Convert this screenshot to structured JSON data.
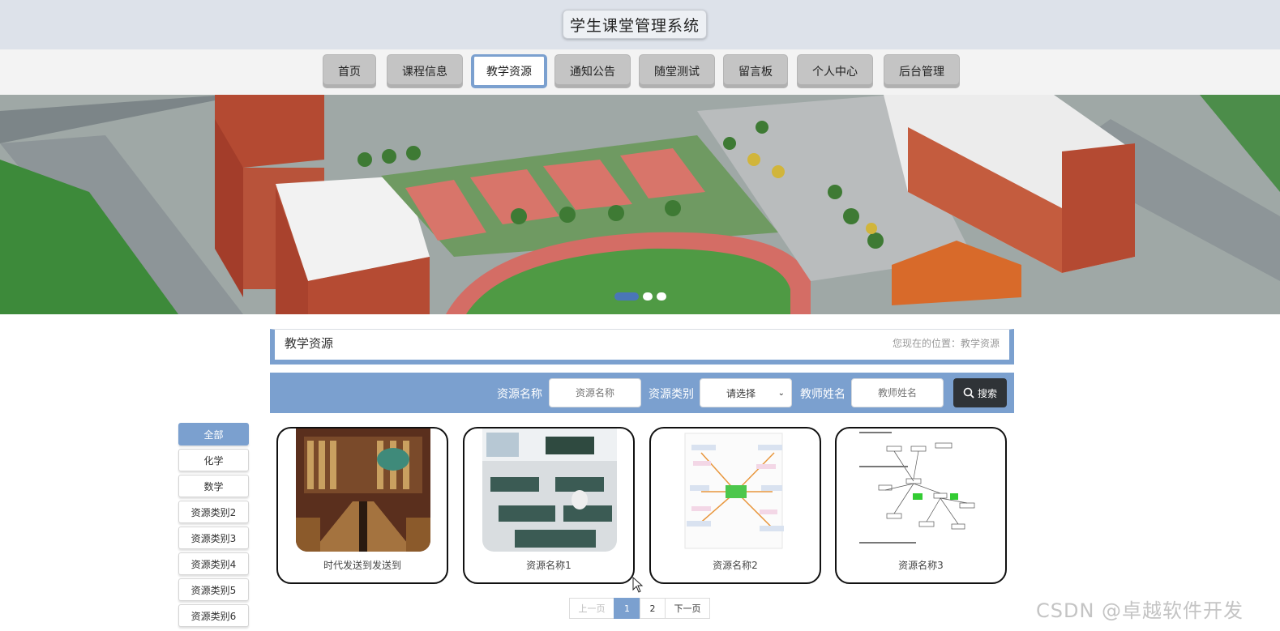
{
  "site": {
    "title": "学生课堂管理系统"
  },
  "nav": {
    "items": [
      {
        "label": "首页"
      },
      {
        "label": "课程信息"
      },
      {
        "label": "教学资源"
      },
      {
        "label": "通知公告"
      },
      {
        "label": "随堂测试"
      },
      {
        "label": "留言板"
      },
      {
        "label": "个人中心"
      },
      {
        "label": "后台管理"
      }
    ],
    "active_index": 2
  },
  "banner": {
    "slide_count": 3,
    "active_slide": 1
  },
  "breadcrumb": {
    "title": "教学资源",
    "path": "您现在的位置：教学资源"
  },
  "search": {
    "name_label": "资源名称",
    "name_placeholder": "资源名称",
    "category_label": "资源类别",
    "category_value": "请选择",
    "teacher_label": "教师姓名",
    "teacher_placeholder": "教师姓名",
    "button_label": "搜索"
  },
  "categories": {
    "items": [
      {
        "label": "全部"
      },
      {
        "label": "化学"
      },
      {
        "label": "数学"
      },
      {
        "label": "资源类别2"
      },
      {
        "label": "资源类别3"
      },
      {
        "label": "资源类别4"
      },
      {
        "label": "资源类别5"
      },
      {
        "label": "资源类别6"
      }
    ],
    "active_index": 0
  },
  "resources": {
    "items": [
      {
        "name": "时代发送到发送到",
        "thumbnail": "library"
      },
      {
        "name": "资源名称1",
        "thumbnail": "lab-classroom"
      },
      {
        "name": "资源名称2",
        "thumbnail": "mind-map"
      },
      {
        "name": "资源名称3",
        "thumbnail": "flow-diagram"
      }
    ]
  },
  "pagination": {
    "prev": "上一页",
    "pages": [
      "1",
      "2"
    ],
    "current": "1",
    "next": "下一页"
  },
  "watermark": "CSDN @卓越软件开发",
  "colors": {
    "accent": "#7ba0cf",
    "header_bg": "#dde2ea",
    "search_button": "#2f3337"
  }
}
